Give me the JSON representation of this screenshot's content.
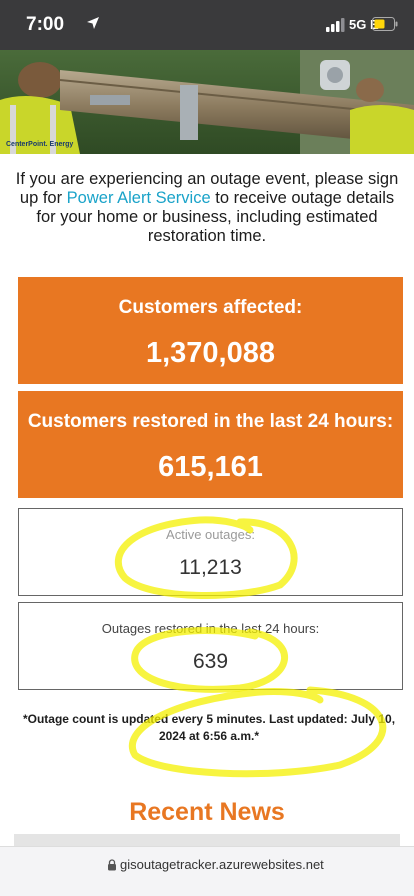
{
  "status_bar": {
    "time": "7:00",
    "network": "5G E",
    "icons": [
      "location-arrow-icon",
      "signal-bars-icon",
      "battery-icon"
    ]
  },
  "hero": {
    "description_icon": "utility-workers-carrying-pole-photo",
    "badge_text": "CenterPoint. Energy"
  },
  "intro": {
    "text_before": "If you are experiencing an outage event, please sign up for ",
    "link": "Power Alert Service",
    "text_after": " to receive outage details for your home or business, including estimated restoration time."
  },
  "stats": {
    "customers_affected": {
      "label": "Customers affected:",
      "value": "1,370,088"
    },
    "customers_restored": {
      "label": "Customers restored in the last 24 hours:",
      "value": "615,161"
    },
    "active_outages": {
      "label": "Active outages:",
      "value": "11,213"
    },
    "outages_restored": {
      "label": "Outages restored in the last 24 hours:",
      "value": "639"
    }
  },
  "update_note": "*Outage count is updated every 5 minutes. Last updated: July 10, 2024 at 6:56 a.m.*",
  "recent_news": {
    "title": "Recent News"
  },
  "url_bar": {
    "url": "gisoutagetracker.azurewebsites.net"
  },
  "colors": {
    "accent_orange": "#e87722",
    "link_blue": "#1aa3c9",
    "highlighter_yellow": "#f4f000",
    "status_bar_bg": "#3a3a3c"
  }
}
